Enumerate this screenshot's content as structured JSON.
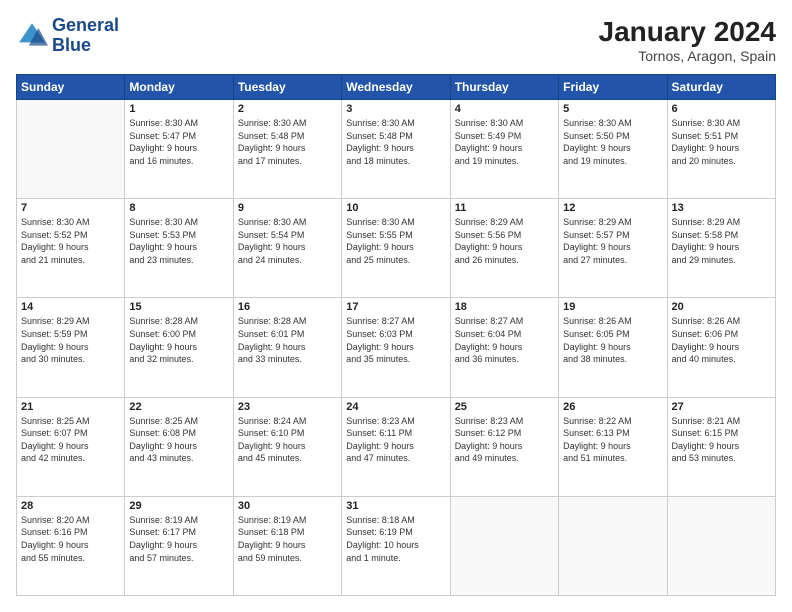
{
  "header": {
    "logo_line1": "General",
    "logo_line2": "Blue",
    "title": "January 2024",
    "subtitle": "Tornos, Aragon, Spain"
  },
  "calendar": {
    "headers": [
      "Sunday",
      "Monday",
      "Tuesday",
      "Wednesday",
      "Thursday",
      "Friday",
      "Saturday"
    ],
    "weeks": [
      [
        {
          "day": "",
          "info": ""
        },
        {
          "day": "1",
          "info": "Sunrise: 8:30 AM\nSunset: 5:47 PM\nDaylight: 9 hours\nand 16 minutes."
        },
        {
          "day": "2",
          "info": "Sunrise: 8:30 AM\nSunset: 5:48 PM\nDaylight: 9 hours\nand 17 minutes."
        },
        {
          "day": "3",
          "info": "Sunrise: 8:30 AM\nSunset: 5:48 PM\nDaylight: 9 hours\nand 18 minutes."
        },
        {
          "day": "4",
          "info": "Sunrise: 8:30 AM\nSunset: 5:49 PM\nDaylight: 9 hours\nand 19 minutes."
        },
        {
          "day": "5",
          "info": "Sunrise: 8:30 AM\nSunset: 5:50 PM\nDaylight: 9 hours\nand 19 minutes."
        },
        {
          "day": "6",
          "info": "Sunrise: 8:30 AM\nSunset: 5:51 PM\nDaylight: 9 hours\nand 20 minutes."
        }
      ],
      [
        {
          "day": "7",
          "info": "Sunrise: 8:30 AM\nSunset: 5:52 PM\nDaylight: 9 hours\nand 21 minutes."
        },
        {
          "day": "8",
          "info": "Sunrise: 8:30 AM\nSunset: 5:53 PM\nDaylight: 9 hours\nand 23 minutes."
        },
        {
          "day": "9",
          "info": "Sunrise: 8:30 AM\nSunset: 5:54 PM\nDaylight: 9 hours\nand 24 minutes."
        },
        {
          "day": "10",
          "info": "Sunrise: 8:30 AM\nSunset: 5:55 PM\nDaylight: 9 hours\nand 25 minutes."
        },
        {
          "day": "11",
          "info": "Sunrise: 8:29 AM\nSunset: 5:56 PM\nDaylight: 9 hours\nand 26 minutes."
        },
        {
          "day": "12",
          "info": "Sunrise: 8:29 AM\nSunset: 5:57 PM\nDaylight: 9 hours\nand 27 minutes."
        },
        {
          "day": "13",
          "info": "Sunrise: 8:29 AM\nSunset: 5:58 PM\nDaylight: 9 hours\nand 29 minutes."
        }
      ],
      [
        {
          "day": "14",
          "info": "Sunrise: 8:29 AM\nSunset: 5:59 PM\nDaylight: 9 hours\nand 30 minutes."
        },
        {
          "day": "15",
          "info": "Sunrise: 8:28 AM\nSunset: 6:00 PM\nDaylight: 9 hours\nand 32 minutes."
        },
        {
          "day": "16",
          "info": "Sunrise: 8:28 AM\nSunset: 6:01 PM\nDaylight: 9 hours\nand 33 minutes."
        },
        {
          "day": "17",
          "info": "Sunrise: 8:27 AM\nSunset: 6:03 PM\nDaylight: 9 hours\nand 35 minutes."
        },
        {
          "day": "18",
          "info": "Sunrise: 8:27 AM\nSunset: 6:04 PM\nDaylight: 9 hours\nand 36 minutes."
        },
        {
          "day": "19",
          "info": "Sunrise: 8:26 AM\nSunset: 6:05 PM\nDaylight: 9 hours\nand 38 minutes."
        },
        {
          "day": "20",
          "info": "Sunrise: 8:26 AM\nSunset: 6:06 PM\nDaylight: 9 hours\nand 40 minutes."
        }
      ],
      [
        {
          "day": "21",
          "info": "Sunrise: 8:25 AM\nSunset: 6:07 PM\nDaylight: 9 hours\nand 42 minutes."
        },
        {
          "day": "22",
          "info": "Sunrise: 8:25 AM\nSunset: 6:08 PM\nDaylight: 9 hours\nand 43 minutes."
        },
        {
          "day": "23",
          "info": "Sunrise: 8:24 AM\nSunset: 6:10 PM\nDaylight: 9 hours\nand 45 minutes."
        },
        {
          "day": "24",
          "info": "Sunrise: 8:23 AM\nSunset: 6:11 PM\nDaylight: 9 hours\nand 47 minutes."
        },
        {
          "day": "25",
          "info": "Sunrise: 8:23 AM\nSunset: 6:12 PM\nDaylight: 9 hours\nand 49 minutes."
        },
        {
          "day": "26",
          "info": "Sunrise: 8:22 AM\nSunset: 6:13 PM\nDaylight: 9 hours\nand 51 minutes."
        },
        {
          "day": "27",
          "info": "Sunrise: 8:21 AM\nSunset: 6:15 PM\nDaylight: 9 hours\nand 53 minutes."
        }
      ],
      [
        {
          "day": "28",
          "info": "Sunrise: 8:20 AM\nSunset: 6:16 PM\nDaylight: 9 hours\nand 55 minutes."
        },
        {
          "day": "29",
          "info": "Sunrise: 8:19 AM\nSunset: 6:17 PM\nDaylight: 9 hours\nand 57 minutes."
        },
        {
          "day": "30",
          "info": "Sunrise: 8:19 AM\nSunset: 6:18 PM\nDaylight: 9 hours\nand 59 minutes."
        },
        {
          "day": "31",
          "info": "Sunrise: 8:18 AM\nSunset: 6:19 PM\nDaylight: 10 hours\nand 1 minute."
        },
        {
          "day": "",
          "info": ""
        },
        {
          "day": "",
          "info": ""
        },
        {
          "day": "",
          "info": ""
        }
      ]
    ]
  }
}
